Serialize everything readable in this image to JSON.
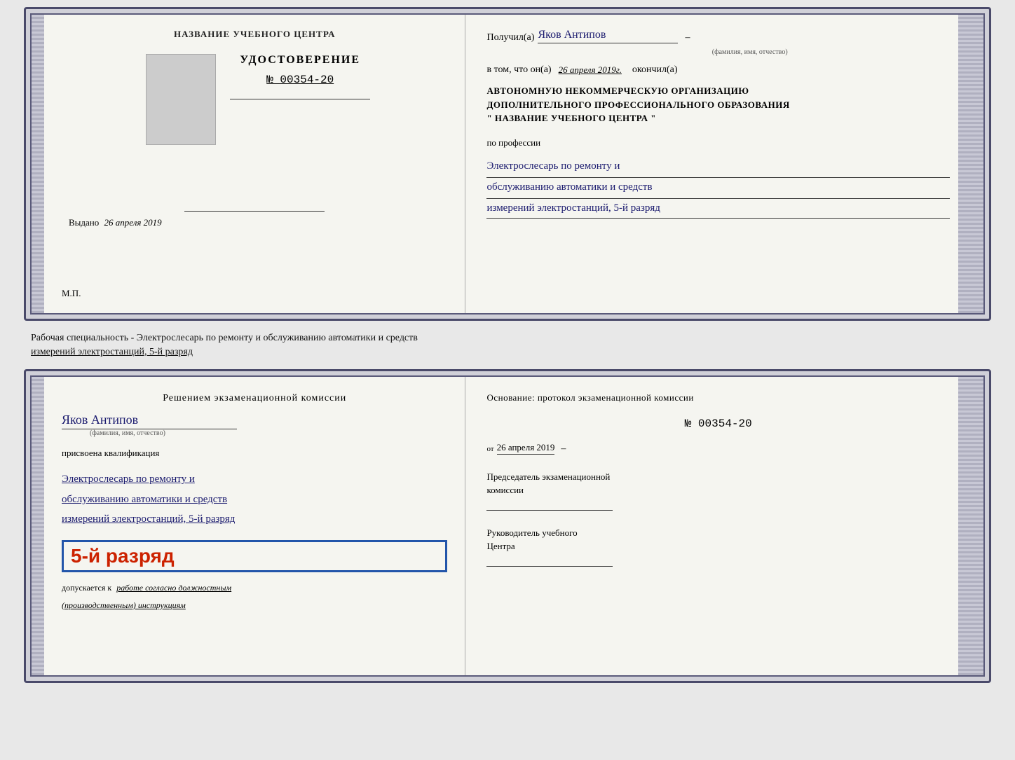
{
  "doc1": {
    "left": {
      "org_name": "НАЗВАНИЕ УЧЕБНОГО ЦЕНТРА",
      "cert_title": "УДОСТОВЕРЕНИЕ",
      "cert_number": "№ 00354-20",
      "issued_label": "Выдано",
      "issued_date": "26 апреля 2019",
      "mp": "М.П."
    },
    "right": {
      "received_label": "Получил(а)",
      "fio_handwritten": "Яков Антипов",
      "fio_subtitle": "(фамилия, имя, отчество)",
      "in_that_label": "в том, что он(а)",
      "date_handwritten": "26 апреля 2019г.",
      "finished_label": "окончил(а)",
      "org_line1": "АВТОНОМНУЮ НЕКОММЕРЧЕСКУЮ ОРГАНИЗАЦИЮ",
      "org_line2": "ДОПОЛНИТЕЛЬНОГО ПРОФЕССИОНАЛЬНОГО ОБРАЗОВАНИЯ",
      "org_line3": "\"   НАЗВАНИЕ УЧЕБНОГО ЦЕНТРА   \"",
      "profession_label": "по профессии",
      "profession_line1": "Электрослесарь по ремонту и",
      "profession_line2": "обслуживанию автоматики и средств",
      "profession_line3": "измерений электростанций, 5-й разряд"
    }
  },
  "between": {
    "text1": "Рабочая специальность - Электрослесарь по ремонту и обслуживанию автоматики и средств",
    "text2": "измерений электростанций, 5-й разряд"
  },
  "doc2": {
    "left": {
      "commission_line1": "Решением экзаменационной комиссии",
      "fio_handwritten": "Яков Антипов",
      "fio_subtitle": "(фамилия, имя, отчество)",
      "assigned_label": "присвоена квалификация",
      "qual_line1": "Электрослесарь по ремонту и",
      "qual_line2": "обслуживанию автоматики и средств",
      "qual_line3": "измерений электростанций, 5-й разряд",
      "rank_badge": "5-й разряд",
      "admit_label": "допускается к",
      "admit_text": "работе согласно должностным",
      "instructions_text": "(производственным) инструкциям"
    },
    "right": {
      "basis_label": "Основание: протокол экзаменационной комиссии",
      "number": "№ 00354-20",
      "date_prefix": "от",
      "date_value": "26 апреля 2019",
      "chairman_label": "Председатель экзаменационной",
      "chairman_label2": "комиссии",
      "head_label": "Руководитель учебного",
      "head_label2": "Центра"
    }
  }
}
